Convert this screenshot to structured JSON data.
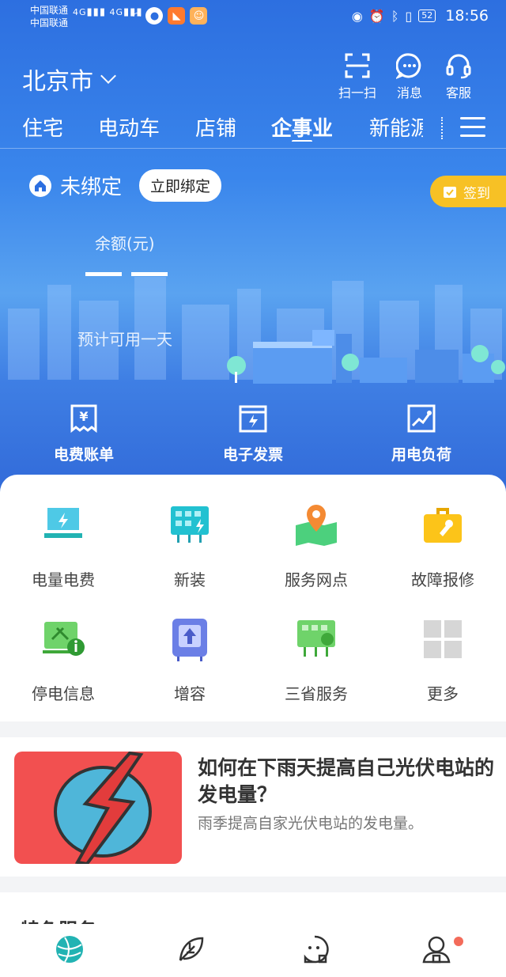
{
  "status_bar": {
    "carrier1": "中国联通",
    "carrier2": "中国联通",
    "signal1": "4G",
    "signal2": "4G",
    "battery": "52",
    "time": "18:56"
  },
  "header": {
    "city": "北京市",
    "actions": [
      {
        "label": "扫一扫",
        "icon": "scan-icon"
      },
      {
        "label": "消息",
        "icon": "message-icon"
      },
      {
        "label": "客服",
        "icon": "headset-icon"
      }
    ]
  },
  "tabs": [
    {
      "label": "住宅",
      "active": false
    },
    {
      "label": "电动车",
      "active": false
    },
    {
      "label": "店铺",
      "active": false
    },
    {
      "label": "企事业",
      "active": true
    },
    {
      "label": "新能源",
      "active": false
    }
  ],
  "account": {
    "status": "未绑定",
    "bind_button": "立即绑定",
    "signin": "签到",
    "balance_label": "余额(元)",
    "estimate": "预计可用一天"
  },
  "quick_actions": [
    {
      "label": "电费账单",
      "icon": "bill-icon"
    },
    {
      "label": "电子发票",
      "icon": "invoice-icon"
    },
    {
      "label": "用电负荷",
      "icon": "load-chart-icon"
    }
  ],
  "services": [
    {
      "label": "电量电费",
      "icon": "power-fee-icon"
    },
    {
      "label": "新装",
      "icon": "new-install-icon"
    },
    {
      "label": "服务网点",
      "icon": "service-map-icon"
    },
    {
      "label": "故障报修",
      "icon": "repair-toolbox-icon"
    },
    {
      "label": "停电信息",
      "icon": "outage-info-icon"
    },
    {
      "label": "增容",
      "icon": "capacity-increase-icon"
    },
    {
      "label": "三省服务",
      "icon": "three-province-icon"
    },
    {
      "label": "更多",
      "icon": "more-grid-icon"
    }
  ],
  "article": {
    "title": "如何在下雨天提高自己光伏电站的发电量？",
    "subtitle": "雨季提高自家光伏电站的发电量。"
  },
  "section_title": "特色服务",
  "bottom_nav": [
    {
      "icon": "home-globe-icon"
    },
    {
      "icon": "leaf-icon"
    },
    {
      "icon": "service-chat-icon"
    },
    {
      "icon": "profile-icon"
    }
  ],
  "colors": {
    "hero_top": "#2d6fe0",
    "signin": "#f7c125",
    "teal": "#22b3b3",
    "article_red": "#f25050"
  }
}
